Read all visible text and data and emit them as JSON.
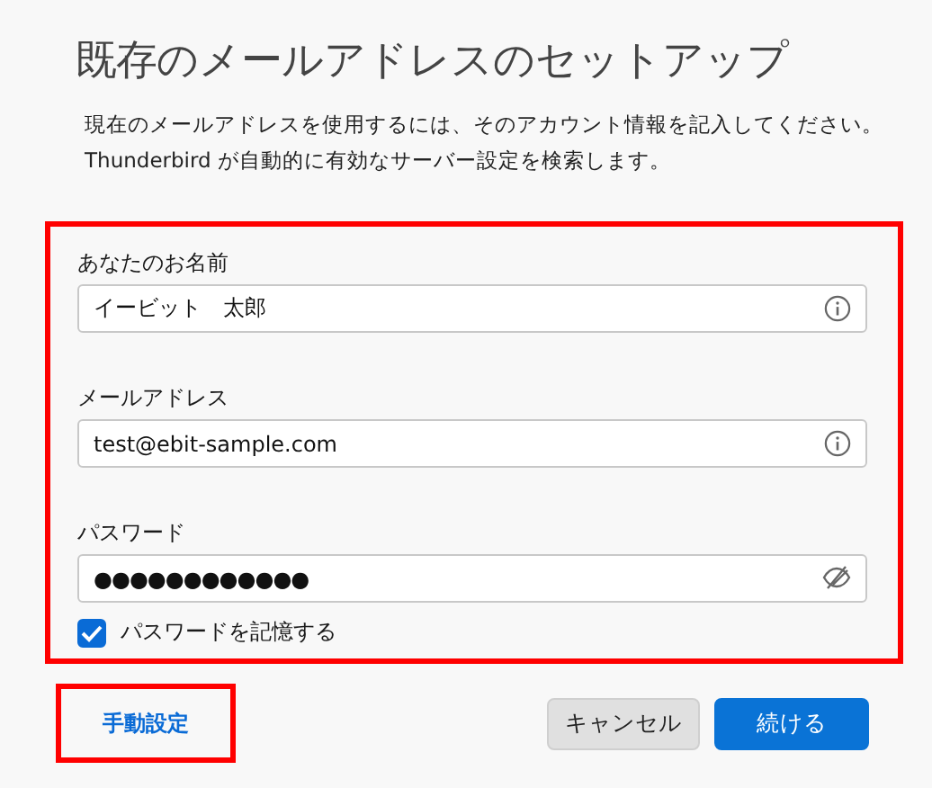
{
  "title": "既存のメールアドレスのセットアップ",
  "description": [
    "現在のメールアドレスを使用するには、そのアカウント情報を記入してください。",
    "Thunderbird が自動的に有効なサーバー設定を検索します。"
  ],
  "form": {
    "highlighted": true,
    "fields": [
      {
        "label": "あなたのお名前",
        "value": "イービット　太郎",
        "kind": "info"
      },
      {
        "label": "メールアドレス",
        "value": "test@ebit-sample.com",
        "kind": "info"
      },
      {
        "label": "パスワード",
        "value": "●●●●●●●●●●●●",
        "kind": "password"
      }
    ],
    "remember": {
      "label": "パスワードを記憶する",
      "checked": true
    }
  },
  "manual": {
    "label": "手動設定",
    "highlighted": true
  },
  "buttons": [
    {
      "label": "キャンセル",
      "kind": "secondary"
    },
    {
      "label": "続ける",
      "kind": "primary"
    }
  ]
}
